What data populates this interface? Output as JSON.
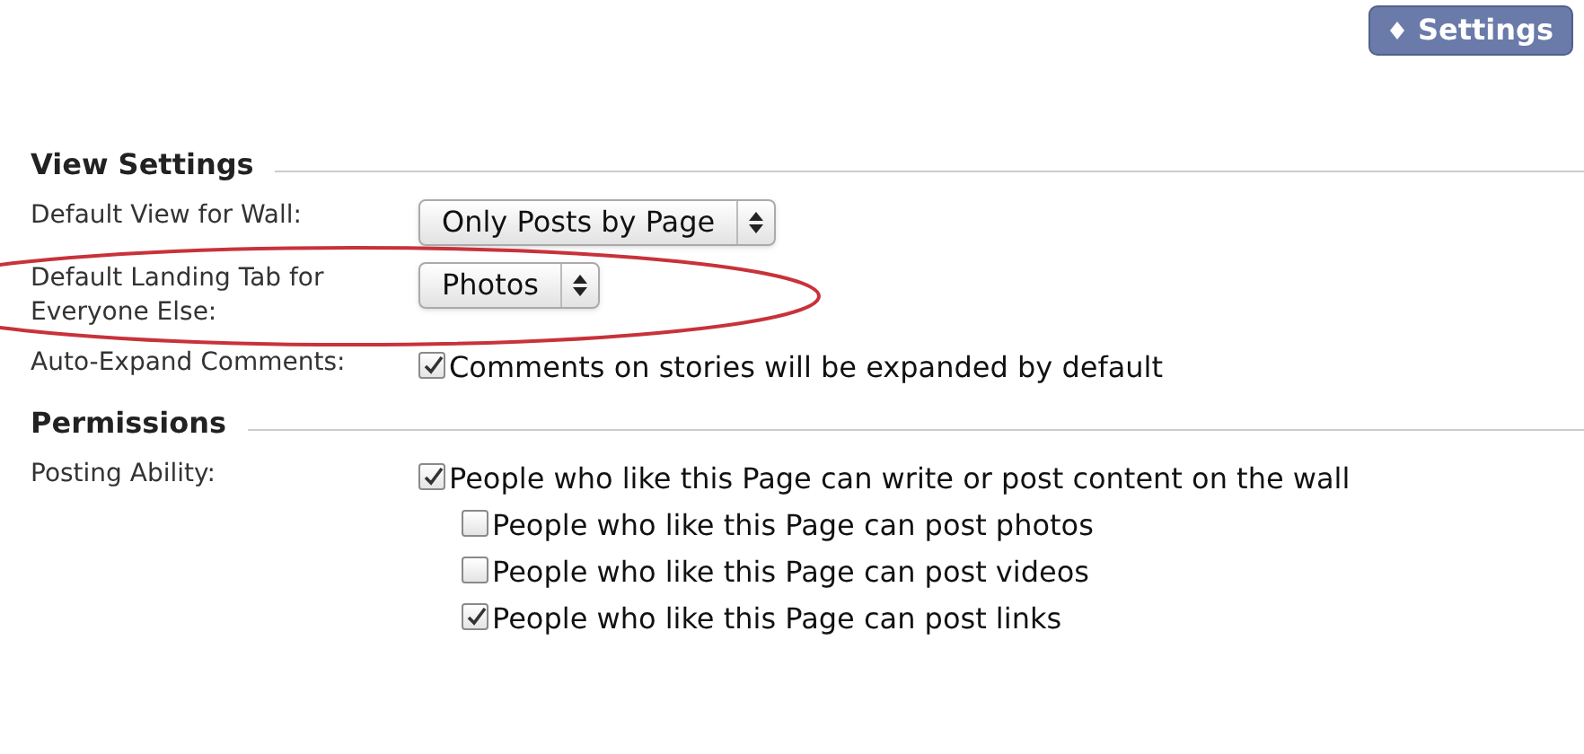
{
  "settings_button": {
    "label": "Settings"
  },
  "sections": [
    {
      "title": "View Settings",
      "rows": [
        {
          "kind": "select",
          "label": "Default View for Wall:",
          "value": "Only Posts by Page",
          "highlighted": false
        },
        {
          "kind": "select",
          "label": "Default Landing Tab for Everyone Else:",
          "value": "Photos",
          "highlighted": true
        },
        {
          "kind": "checkboxes",
          "label": "Auto-Expand Comments:",
          "options": [
            {
              "label": "Comments on stories will be expanded by default",
              "checked": true
            }
          ]
        }
      ]
    },
    {
      "title": "Permissions",
      "rows": [
        {
          "kind": "checkboxes",
          "label": "Posting Ability:",
          "options": [
            {
              "label": "People who like this Page can write or post content on the wall",
              "checked": true,
              "children": [
                {
                  "label": "People who like this Page can post photos",
                  "checked": false
                },
                {
                  "label": "People who like this Page can post videos",
                  "checked": false
                },
                {
                  "label": "People who like this Page can post links",
                  "checked": true
                }
              ]
            }
          ]
        }
      ]
    }
  ]
}
